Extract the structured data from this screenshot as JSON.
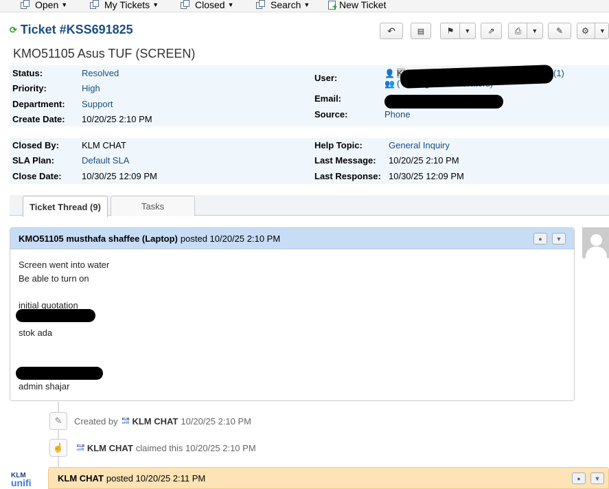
{
  "nav": {
    "open": "Open",
    "my_tickets": "My Tickets",
    "closed": "Closed",
    "search": "Search",
    "new_ticket": "New Ticket"
  },
  "header": {
    "ticket_number": "Ticket #KSS691825",
    "subject": "KMO51105 Asus TUF (SCREEN)"
  },
  "info1": {
    "status_label": "Status:",
    "status": "Resolved",
    "priority_label": "Priority:",
    "priority": "High",
    "department_label": "Department:",
    "department": "Support",
    "create_date_label": "Create Date:",
    "create_date": "10/20/25 2:10 PM",
    "user_label": "User:",
    "user_prefix": "KI",
    "user_suffix": "(1)",
    "manage_collaborators": "( Manage Collaborators)",
    "email_label": "Email:",
    "source_label": "Source:",
    "source": "Phone"
  },
  "info2": {
    "closed_by_label": "Closed By:",
    "closed_by": "KLM CHAT",
    "sla_label": "SLA Plan:",
    "sla": "Default SLA",
    "close_date_label": "Close Date:",
    "close_date": "10/30/25 12:09 PM",
    "help_topic_label": "Help Topic:",
    "help_topic": "General Inquiry",
    "last_message_label": "Last Message:",
    "last_message": "10/20/25 2:10 PM",
    "last_response_label": "Last Response:",
    "last_response": "10/30/25 12:09 PM"
  },
  "tabs": {
    "thread": "Ticket Thread (9)",
    "tasks": "Tasks"
  },
  "entry1": {
    "author": "KMO51105 musthafa shaffee (Laptop)",
    "posted": "posted 10/20/25 2:10 PM",
    "lines": [
      "Screen went into water",
      "Be able to turn on",
      "initial quotation",
      "stok ada",
      "admin shajar"
    ]
  },
  "events": {
    "created_by": "Created by",
    "created_author": "KLM CHAT",
    "created_time": "10/20/25 2:10 PM",
    "claimed_author": "KLM CHAT",
    "claimed_text": "claimed this 10/20/25 2:10 PM"
  },
  "entry2": {
    "author": "KLM CHAT",
    "posted": "posted 10/20/25 2:11 PM"
  },
  "logo": {
    "klm": "KLM",
    "unifi": "unifi"
  }
}
